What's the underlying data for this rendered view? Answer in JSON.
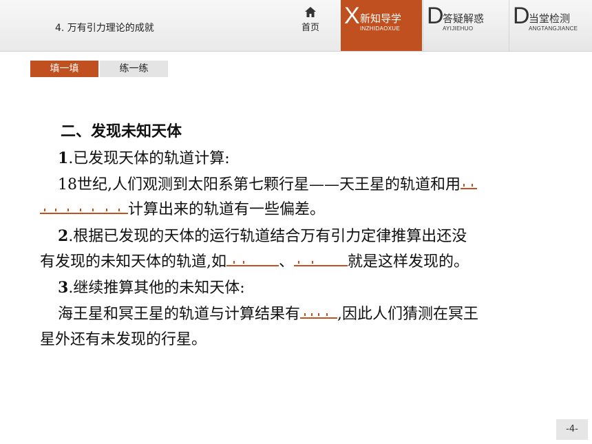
{
  "header": {
    "lesson_title": "4. 万有引力理论的成就",
    "home_label": "首页",
    "tabs": [
      {
        "letter": "X",
        "label": "新知导学",
        "pinyin": "INZHIDAOXUE",
        "active": true
      },
      {
        "letter": "D",
        "label": "答疑解惑",
        "pinyin": "AYIJIEHUO",
        "active": false
      },
      {
        "letter": "D",
        "label": "当堂检测",
        "pinyin": "ANGTANGJIANCE",
        "active": false
      }
    ]
  },
  "subtabs": {
    "fill": "填一填",
    "practice": "练一练"
  },
  "content": {
    "heading": "二、发现未知天体",
    "item1_num": "1",
    "item1_text": ".已发现天体的轨道计算:",
    "item1_body_a": "18世纪,人们观测到太阳系第七颗行星——天王星的轨道和用",
    "item1_body_b": "计算出来的轨道有一些偏差。",
    "item2_num": "2",
    "item2_text_a": ".根据已发现的天体的运行轨道结合万有引力定律推算出还没",
    "item2_text_b": "有发现的未知天体的轨道,如",
    "item2_sep": "、",
    "item2_text_c": "就是这样发现的。",
    "item3_num": "3",
    "item3_text": ".继续推算其他的未知天体:",
    "item3_body_a": "海王星和冥王星的轨道与计算结果有",
    "item3_body_b": ",因此人们猜测在冥王",
    "item3_body_c": "星外还有未发现的行星。"
  },
  "page_number": "-4-",
  "colors": {
    "accent": "#c0501f",
    "header_bg": "#efefef",
    "subtab_inactive": "#e4e4e4"
  },
  "icons": {
    "home": "home-icon"
  }
}
